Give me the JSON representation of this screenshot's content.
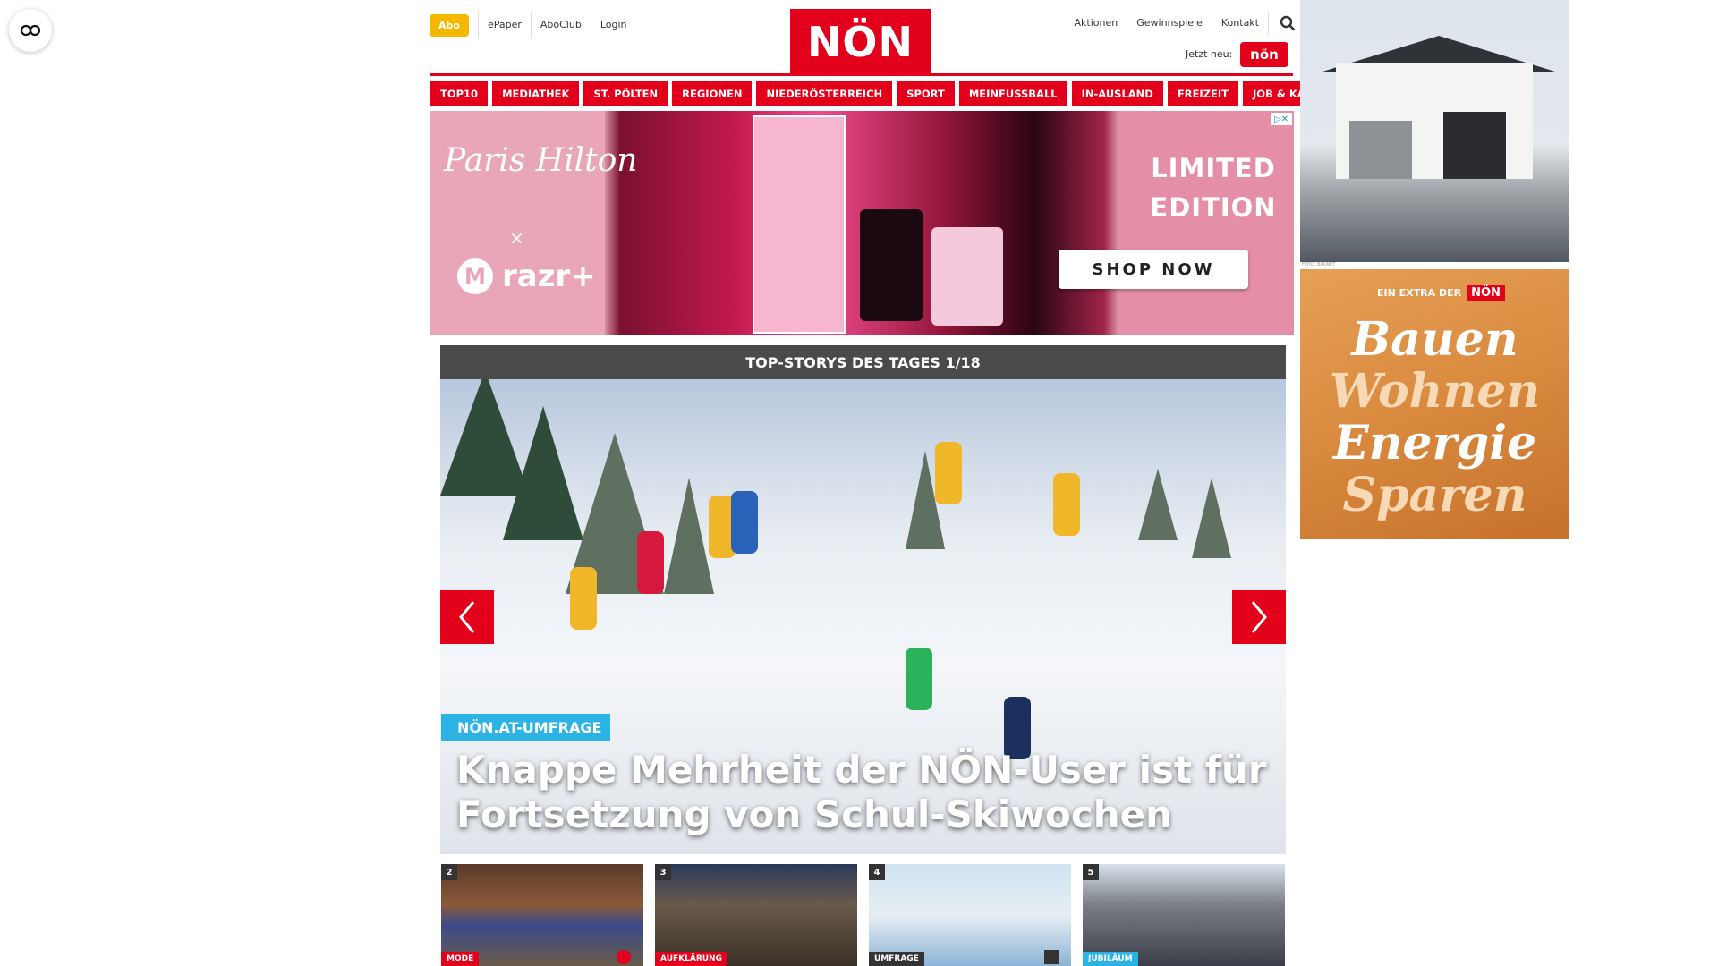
{
  "header": {
    "abo_label": "Abo",
    "left_links": [
      "ePaper",
      "AboClub",
      "Login"
    ],
    "logo_text": "NÖN",
    "right_links": [
      "Aktionen",
      "Gewinnspiele",
      "Kontakt"
    ],
    "jetzt_neu_label": "Jetzt neu:",
    "jetzt_neu_badge": "nön"
  },
  "categories": [
    "TOP10",
    "MEDIATHEK",
    "ST. PÖLTEN",
    "REGIONEN",
    "NIEDERÖSTERREICH",
    "SPORT",
    "MEINFUSSBALL",
    "IN-AUSLAND",
    "FREIZEIT",
    "JOB & KARRIERE"
  ],
  "ad": {
    "brand_left": "Paris Hilton",
    "brand_x": "×",
    "brand_razr": "razr+",
    "limited_line1": "LIMITED",
    "limited_line2": "EDITION",
    "cta": "SHOP NOW",
    "accent": "#e8a6b8"
  },
  "top_stories": {
    "bar_title": "TOP-STORYS DES TAGES 1/18",
    "tag": "NÖN.AT-UMFRAGE",
    "tag_color": "#2bb3e6",
    "headline": "Knappe Mehrheit der NÖN-User ist für Fortsetzung von Schul-Skiwochen"
  },
  "thumbnails": [
    {
      "num": "2",
      "tag": "MODE",
      "tag_color": "#e2001a"
    },
    {
      "num": "3",
      "tag": "AUFKLÄRUNG",
      "tag_color": "#e2001a"
    },
    {
      "num": "4",
      "tag": "UMFRAGE",
      "tag_color": "#333333"
    },
    {
      "num": "5",
      "tag": "JUBILÄUM",
      "tag_color": "#2bb3e6"
    }
  ],
  "right_ads": {
    "foto_credit": "FOTO: BAUNET",
    "extra_label": "EIN EXTRA DER",
    "extra_logo": "NÖN",
    "words": [
      "Bauen",
      "Wohnen",
      "Energie",
      "Sparen"
    ]
  },
  "colors": {
    "brand_red": "#e2001a",
    "abo_yellow": "#f5b800"
  }
}
